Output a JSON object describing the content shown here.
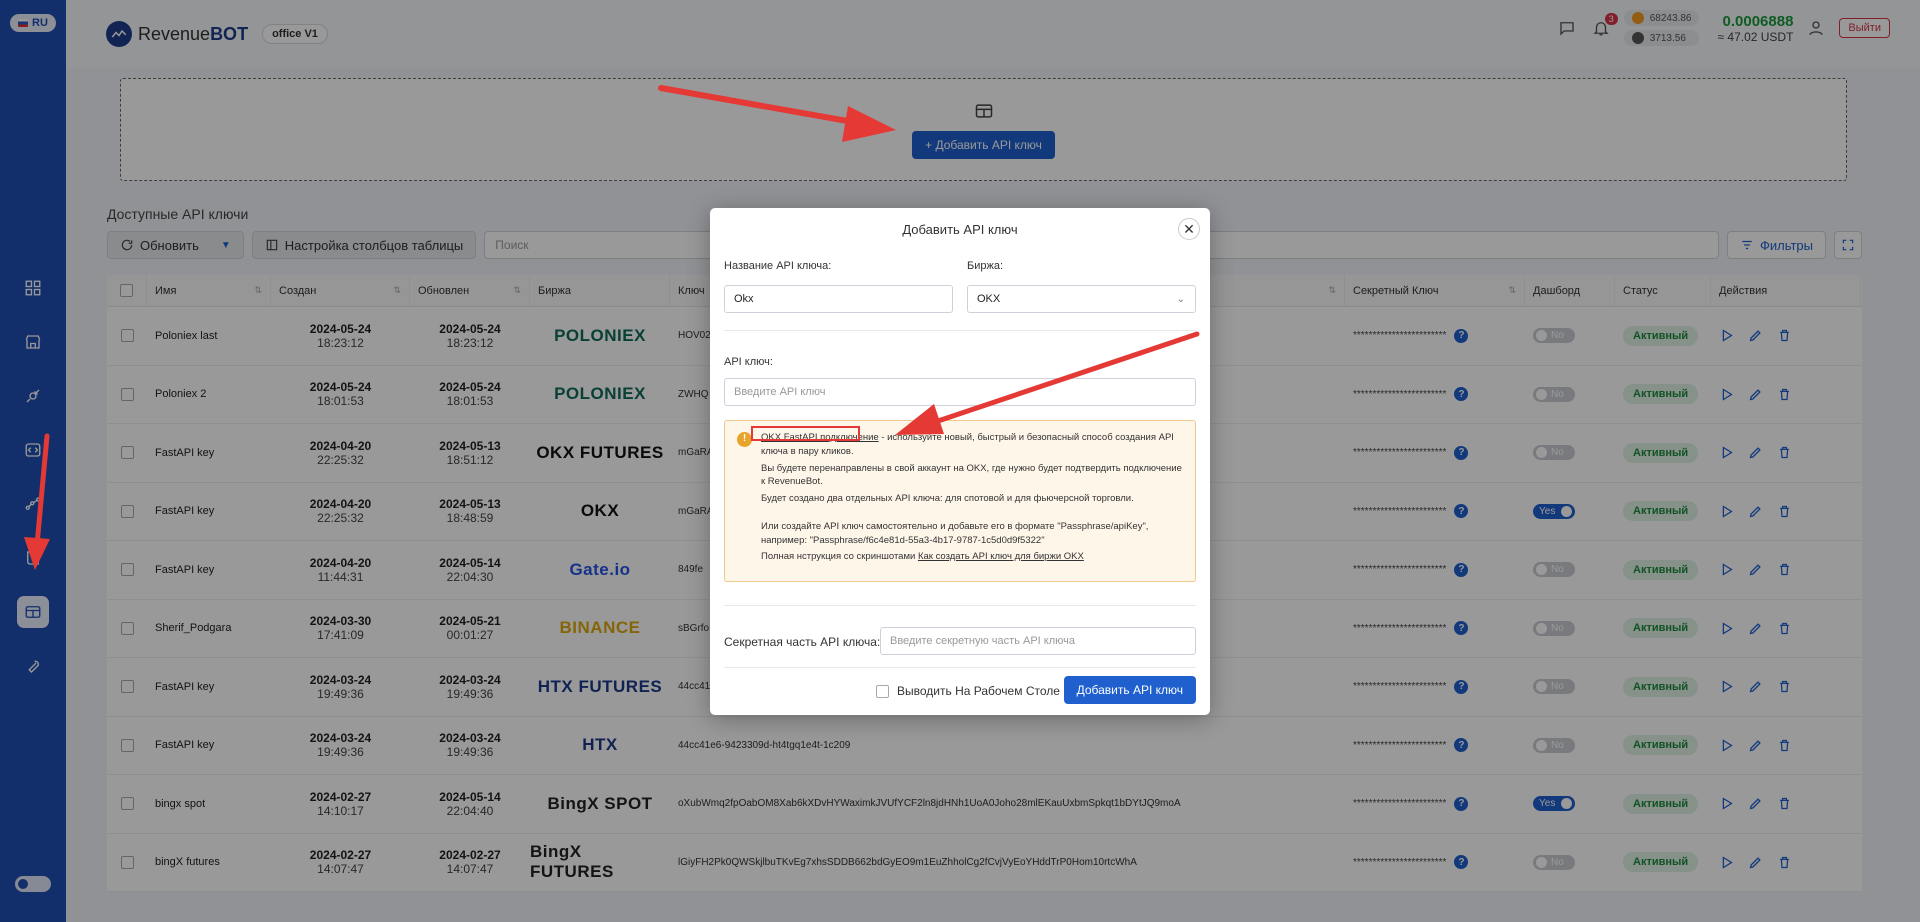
{
  "sidebar": {
    "lang": "RU",
    "items": [
      {
        "name": "dashboard-icon"
      },
      {
        "name": "store-icon"
      },
      {
        "name": "bot-icon"
      },
      {
        "name": "code-icon"
      },
      {
        "name": "chart-icon"
      },
      {
        "name": "book-icon"
      },
      {
        "name": "api-keys-icon"
      },
      {
        "name": "wrench-icon"
      }
    ]
  },
  "header": {
    "logo_prefix": "Revenue",
    "logo_bold": "BOT",
    "office": "office V1",
    "notif_count": "3",
    "btc_price": "68243.86",
    "eth_price": "3713.56",
    "balance_main": "0.0006888",
    "balance_sub": "≈ 47.02 USDT",
    "logout": "Выйти"
  },
  "main": {
    "add_key_button": "+ Добавить API ключ",
    "section_title": "Доступные API ключи",
    "toolbar": {
      "refresh": "Обновить",
      "columns": "Настройка столбцов таблицы",
      "search_placeholder": "Поиск",
      "filters": "Фильтры"
    },
    "columns": [
      "Имя",
      "Создан",
      "Обновлен",
      "Биржа",
      "Ключ",
      "Секретный Ключ",
      "Дашборд",
      "Статус",
      "Действия"
    ],
    "rows": [
      {
        "name": "Poloniex last",
        "created_d": "2024-05-24",
        "created_t": "18:23:12",
        "updated_d": "2024-05-24",
        "updated_t": "18:23:12",
        "exchange": "POLONIEX",
        "key": "HOV02",
        "secret": "************************",
        "dash": "No",
        "status": "Активный"
      },
      {
        "name": "Poloniex 2",
        "created_d": "2024-05-24",
        "created_t": "18:01:53",
        "updated_d": "2024-05-24",
        "updated_t": "18:01:53",
        "exchange": "POLONIEX",
        "key": "ZWHQ",
        "secret": "************************",
        "dash": "No",
        "status": "Активный"
      },
      {
        "name": "FastAPI key",
        "created_d": "2024-04-20",
        "created_t": "22:25:32",
        "updated_d": "2024-05-13",
        "updated_t": "18:51:12",
        "exchange": "OKX FUTURES",
        "key": "mGaRA",
        "secret": "************************",
        "dash": "No",
        "status": "Активный"
      },
      {
        "name": "FastAPI key",
        "created_d": "2024-04-20",
        "created_t": "22:25:32",
        "updated_d": "2024-05-13",
        "updated_t": "18:48:59",
        "exchange": "OKX",
        "key": "mGaRA",
        "secret": "************************",
        "dash": "Yes",
        "status": "Активный"
      },
      {
        "name": "FastAPI key",
        "created_d": "2024-04-20",
        "created_t": "11:44:31",
        "updated_d": "2024-05-14",
        "updated_t": "22:04:30",
        "exchange": "Gate.io",
        "key": "849fe",
        "secret": "************************",
        "dash": "No",
        "status": "Активный"
      },
      {
        "name": "Sherif_Podgara",
        "created_d": "2024-03-30",
        "created_t": "17:41:09",
        "updated_d": "2024-05-21",
        "updated_t": "00:01:27",
        "exchange": "BINANCE",
        "key": "sBGrfo",
        "secret": "************************",
        "dash": "No",
        "status": "Активный"
      },
      {
        "name": "FastAPI key",
        "created_d": "2024-03-24",
        "created_t": "19:49:36",
        "updated_d": "2024-03-24",
        "updated_t": "19:49:36",
        "exchange": "HTX FUTURES",
        "key": "44cc41",
        "secret": "************************",
        "dash": "No",
        "status": "Активный"
      },
      {
        "name": "FastAPI key",
        "created_d": "2024-03-24",
        "created_t": "19:49:36",
        "updated_d": "2024-03-24",
        "updated_t": "19:49:36",
        "exchange": "HTX",
        "key": "44cc41e6-9423309d-ht4tgq1e4t-1c209",
        "secret": "************************",
        "dash": "No",
        "status": "Активный"
      },
      {
        "name": "bingx spot",
        "created_d": "2024-02-27",
        "created_t": "14:10:17",
        "updated_d": "2024-05-14",
        "updated_t": "22:04:40",
        "exchange": "BingX SPOT",
        "key": "oXubWmq2fpOabOM8Xab6kXDvHYWaximkJVUfYCF2ln8jdHNh1UoA0Joho28mlEKauUxbmSpkqt1bDYtJQ9moA",
        "secret": "************************",
        "dash": "Yes",
        "status": "Активный"
      },
      {
        "name": "bingX futures",
        "created_d": "2024-02-27",
        "created_t": "14:07:47",
        "updated_d": "2024-02-27",
        "updated_t": "14:07:47",
        "exchange": "BingX FUTURES",
        "key": "lGiyFH2Pk0QWSkjlbuTKvEg7xhsSDDB662bdGyEO9m1EuZhholCg2fCvjVyEoYHddTrP0Hom10rtcWhA",
        "secret": "************************",
        "dash": "No",
        "status": "Активный"
      }
    ]
  },
  "modal": {
    "title": "Добавить API ключ",
    "name_label": "Название API ключа:",
    "name_value": "Okx",
    "exchange_label": "Биржа:",
    "exchange_value": "OKX",
    "api_key_label": "API ключ:",
    "api_key_placeholder": "Введите API ключ",
    "alert_link": "OKX FastAPI подключение",
    "alert_line1_rest": " - используйте новый, быстрый и безопасный способ создания API ключа в пару кликов.",
    "alert_line2": "Вы будете перенаправлены в свой аккаунт на OKX, где нужно будет подтвердить подключение к RevenueBot.",
    "alert_line3": "Будет создано два отдельных API ключа: для спотовой и для фьючерсной торговли.",
    "alert_line4": "Или создайте API ключ самостоятельно и добавьте его в формате \"Passphrase/apiKey\", например: \"Passphrase/f6c4e81d-55a3-4b17-9787-1c5d0d9f5322\"",
    "alert_line5_prefix": "Полная нструкция со скриншотами ",
    "alert_line5_link": "Как создать API ключ для биржи OKX",
    "secret_label": "Секретная часть API ключа:",
    "secret_placeholder": "Введите секретную часть API ключа",
    "desktop_checkbox": "Выводить На Рабочем Столе",
    "submit": "Добавить API ключ"
  },
  "colors": {
    "sidebar": "#1f4fb3",
    "primary": "#1f5fce",
    "success": "#1f8a3f",
    "danger": "#d9334a",
    "annotation": "#e53935"
  }
}
